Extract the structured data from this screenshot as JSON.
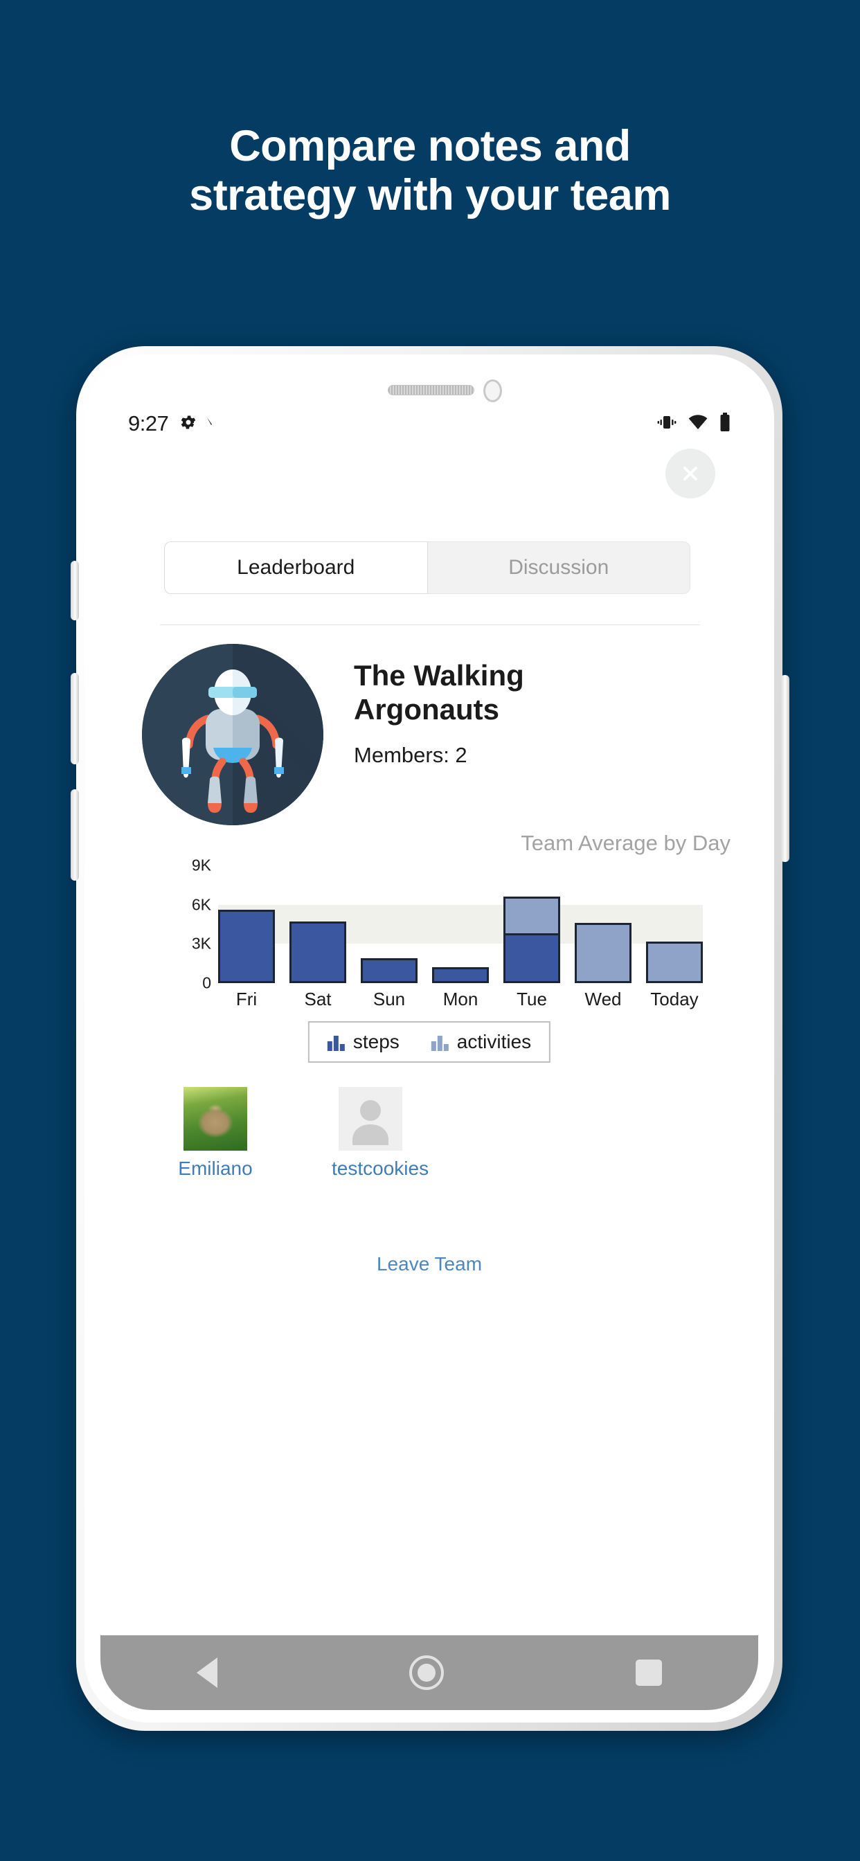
{
  "promo": {
    "headline_line1": "Compare notes and",
    "headline_line2": "strategy with your team",
    "background_color": "#043c63",
    "headline_color": "#ffffff"
  },
  "status_bar": {
    "time": "9:27",
    "left_icons": [
      "gear-icon",
      "small-caret-icon"
    ],
    "right_icons": [
      "vibrate-icon",
      "wifi-icon",
      "battery-icon"
    ]
  },
  "screen": {
    "close_button": "close-icon",
    "tabs": [
      {
        "label": "Leaderboard",
        "active": true
      },
      {
        "label": "Discussion",
        "active": false
      }
    ],
    "team": {
      "avatar": "robot-avatar",
      "name_line1": "The Walking",
      "name_line2": "Argonauts",
      "members_label": "Members: 2"
    },
    "members": [
      {
        "name": "Emiliano",
        "avatar": "cat-photo"
      },
      {
        "name": "testcookies",
        "avatar": "person-placeholder-icon"
      }
    ],
    "leave_team_label": "Leave Team",
    "link_color": "#4e86c0"
  },
  "chart_data": {
    "type": "bar",
    "title": "Team Average by Day",
    "xlabel": "",
    "ylabel": "",
    "categories": [
      "Fri",
      "Sat",
      "Sun",
      "Mon",
      "Tue",
      "Wed",
      "Today"
    ],
    "series": [
      {
        "name": "steps",
        "color": "#3b57a0",
        "values": [
          5600,
          4700,
          1900,
          1200,
          3800,
          0,
          0
        ]
      },
      {
        "name": "activities",
        "color": "#8fa3c8",
        "values": [
          0,
          0,
          0,
          0,
          2800,
          4600,
          3200
        ]
      }
    ],
    "stacked": true,
    "ylim": [
      0,
      9000
    ],
    "yticks": [
      0,
      3000,
      6000,
      9000
    ],
    "ytick_labels": [
      "0",
      "3K",
      "6K",
      "9K"
    ],
    "target_band": {
      "from": 3000,
      "to": 6000,
      "color": "#f1f1ec"
    },
    "grid": false,
    "legend_position": "bottom",
    "legend": [
      {
        "label": "steps",
        "color": "#3b57a0"
      },
      {
        "label": "activities",
        "color": "#8fa3c8"
      }
    ]
  },
  "nav_bar": {
    "back": "back-triangle-icon",
    "home": "home-circle-icon",
    "recents": "recents-square-icon"
  }
}
